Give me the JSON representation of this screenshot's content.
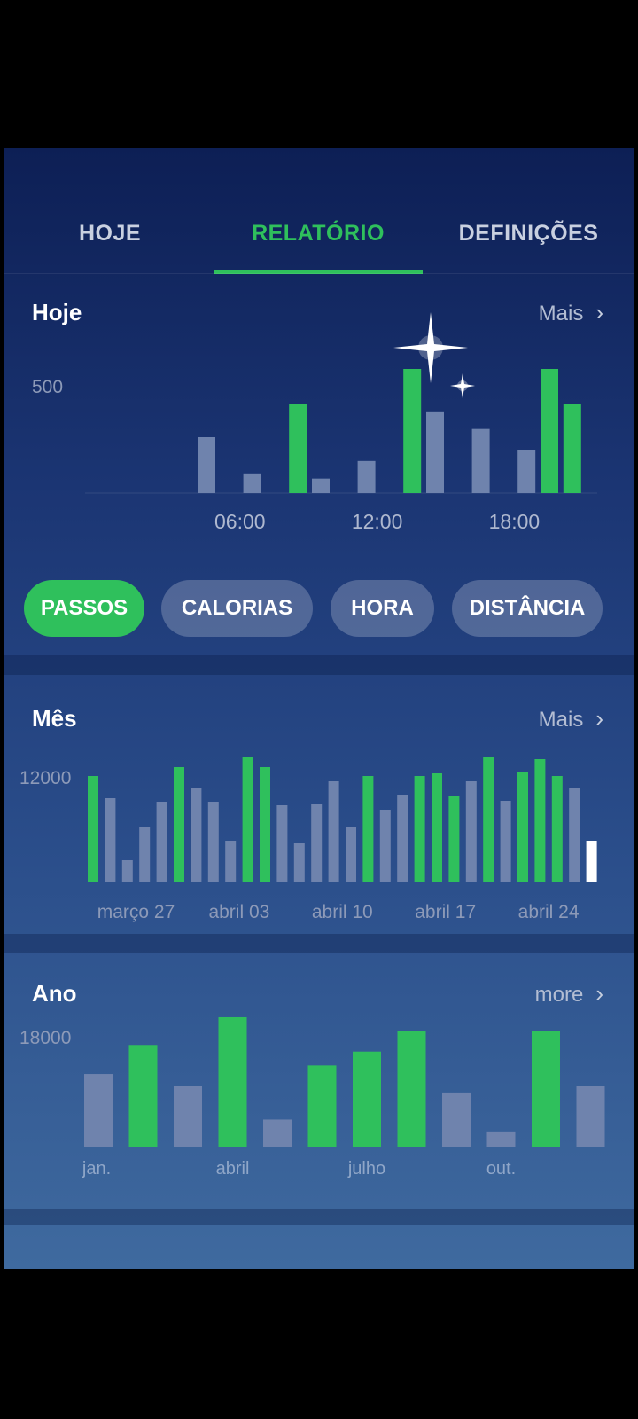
{
  "tabs": [
    {
      "label": "HOJE",
      "active": false
    },
    {
      "label": "RELATÓRIO",
      "active": true
    },
    {
      "label": "DEFINIÇÕES",
      "active": false
    }
  ],
  "colors": {
    "accent": "#2fc05c",
    "inactive_bar": "#6f83ad",
    "current_bar": "#ffffff"
  },
  "today": {
    "title": "Hoje",
    "more_label": "Mais",
    "chips": [
      {
        "label": "PASSOS",
        "active": true
      },
      {
        "label": "CALORIAS",
        "active": false
      },
      {
        "label": "HORA",
        "active": false
      },
      {
        "label": "DISTÂNCIA",
        "active": false
      }
    ]
  },
  "month": {
    "title": "Mês",
    "more_label": "Mais"
  },
  "year": {
    "title": "Ano",
    "more_label": "more"
  },
  "chart_data": [
    {
      "type": "bar",
      "name": "today",
      "ytick": 500,
      "ymax": 600,
      "x_ticks": [
        "06:00",
        "12:00",
        "18:00"
      ],
      "x_tick_positions": [
        6,
        12,
        18
      ],
      "x_range": [
        0,
        24
      ],
      "bars": [
        {
          "x": 5,
          "value": 270,
          "highlight": false
        },
        {
          "x": 7,
          "value": 95,
          "highlight": false
        },
        {
          "x": 9,
          "value": 430,
          "highlight": true
        },
        {
          "x": 10,
          "value": 70,
          "highlight": false
        },
        {
          "x": 12,
          "value": 155,
          "highlight": false
        },
        {
          "x": 14,
          "value": 600,
          "highlight": true
        },
        {
          "x": 15,
          "value": 395,
          "highlight": false
        },
        {
          "x": 17,
          "value": 310,
          "highlight": false
        },
        {
          "x": 19,
          "value": 210,
          "highlight": false
        },
        {
          "x": 20,
          "value": 600,
          "highlight": true
        },
        {
          "x": 21,
          "value": 430,
          "highlight": true
        }
      ]
    },
    {
      "type": "bar",
      "name": "month",
      "ytick": 12000,
      "ymax": 14000,
      "x_ticks": [
        "março 27",
        "abril 03",
        "abril 10",
        "abril 17",
        "abril 24"
      ],
      "x_tick_indices": [
        2.5,
        8.5,
        14.5,
        20.5,
        26.5
      ],
      "values": [
        11900,
        9400,
        2400,
        6200,
        9000,
        12900,
        10500,
        9000,
        4600,
        14000,
        12900,
        8600,
        4400,
        8800,
        11300,
        6200,
        11900,
        8100,
        9800,
        11900,
        12200,
        9700,
        11300,
        14000,
        9100,
        12300,
        13800,
        11900,
        10500,
        4600
      ],
      "highlight": [
        true,
        false,
        false,
        false,
        false,
        true,
        false,
        false,
        false,
        true,
        true,
        false,
        false,
        false,
        false,
        false,
        true,
        false,
        false,
        true,
        true,
        true,
        false,
        true,
        false,
        true,
        true,
        true,
        false,
        false
      ],
      "current_index": 29
    },
    {
      "type": "bar",
      "name": "year",
      "ytick": 18000,
      "ymax": 20000,
      "x_ticks": [
        "jan.",
        "abril",
        "julho",
        "out."
      ],
      "x_tick_indices": [
        0,
        3,
        6,
        9
      ],
      "values": [
        11000,
        15400,
        9200,
        19600,
        4100,
        12300,
        14400,
        17500,
        8200,
        2300,
        17500,
        9200
      ],
      "highlight": [
        false,
        true,
        false,
        true,
        false,
        true,
        true,
        true,
        false,
        false,
        true,
        false
      ]
    }
  ]
}
